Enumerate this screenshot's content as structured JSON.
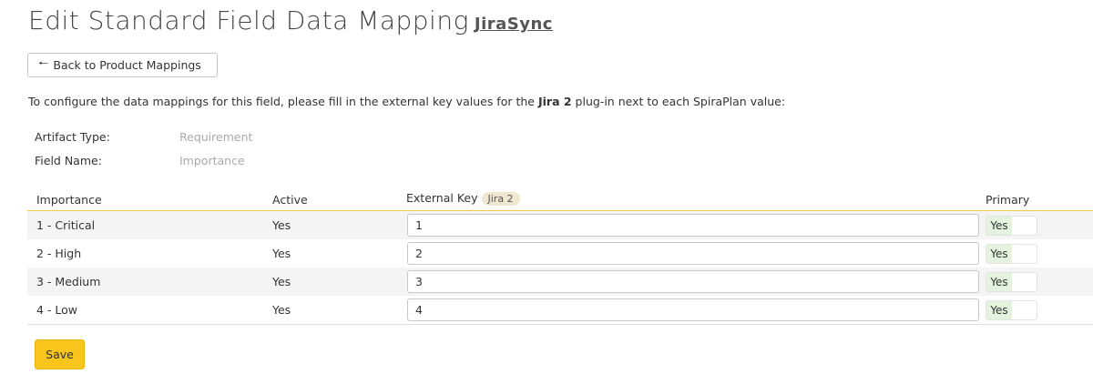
{
  "header": {
    "title": "Edit Standard Field Data Mapping",
    "plugin_link": "JiraSync"
  },
  "back_button": {
    "icon": "arrow-left-icon",
    "label": "Back to Product Mappings"
  },
  "instructions": {
    "prefix": "To configure the data mappings for this field, please fill in the external key values for the",
    "plugin": "Jira 2",
    "suffix": "plug-in next to each SpiraPlan value:"
  },
  "meta": {
    "artifact_type_label": "Artifact Type:",
    "artifact_type_value": "Requirement",
    "field_name_label": "Field Name:",
    "field_name_value": "Importance"
  },
  "grid": {
    "columns": {
      "importance": "Importance",
      "active": "Active",
      "external_key": "External Key",
      "external_key_badge": "Jira 2",
      "primary": "Primary"
    },
    "rows": [
      {
        "importance": "1 - Critical",
        "active": "Yes",
        "external_key": "1",
        "primary": "Yes"
      },
      {
        "importance": "2 - High",
        "active": "Yes",
        "external_key": "2",
        "primary": "Yes"
      },
      {
        "importance": "3 - Medium",
        "active": "Yes",
        "external_key": "3",
        "primary": "Yes"
      },
      {
        "importance": "4 - Low",
        "active": "Yes",
        "external_key": "4",
        "primary": "Yes"
      }
    ]
  },
  "save_button": {
    "label": "Save"
  },
  "colors": {
    "accent": "#f8c51c",
    "header_rule": "#f2c94c",
    "toggle_on": "#e3f3dd"
  }
}
